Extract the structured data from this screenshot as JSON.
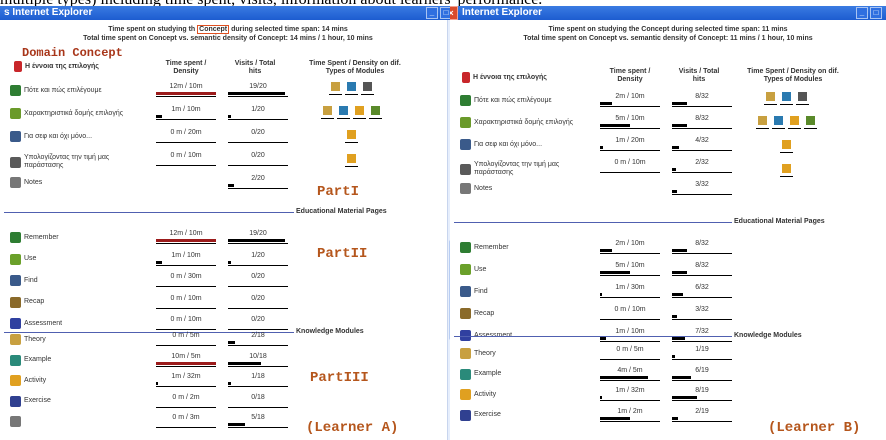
{
  "caption": "multiple types) including time spent, visits, information about learners' performance.",
  "winA": {
    "title": "s Internet Explorer",
    "time_line1_a": "Time spent on studying th",
    "time_line1_concept": "Concept",
    "time_line1_b": "during selected time span: 14 mins",
    "time_line2": "Total time spent on Concept vs. semantic density of Concept: 14 mins / 1 hour, 10 mins",
    "domain_concept": "Domain Concept",
    "concept_name": "Η έννοια της επιλογής",
    "hdr_time": "Time spent / Density",
    "hdr_visits": "Visits / Total hits",
    "hdr_modules": "Time Spent / Density on dif. Types of Modules",
    "rows1": [
      {
        "label": "Πότε και πώς επιλέγουμε",
        "time": "12m / 10m",
        "visits": "19/20",
        "red": 1,
        "tf": 1.0,
        "vf": 0.95
      },
      {
        "label": "Χαρακτηριστικά δομής επιλογής",
        "time": "1m / 10m",
        "visits": "1/20",
        "red": 0,
        "tf": 0.1,
        "vf": 0.05
      },
      {
        "label": "Για σεφ και όχι μόνο...",
        "time": "0 m / 20m",
        "visits": "0/20",
        "red": 0,
        "tf": 0,
        "vf": 0
      },
      {
        "label": "Υπολογίζοντας την τιμή μας παράστασης",
        "time": "0 m / 10m",
        "visits": "0/20",
        "red": 0,
        "tf": 0,
        "vf": 0
      },
      {
        "label": "Notes",
        "time": "",
        "visits": "2/20",
        "red": 0,
        "tf": 0,
        "vf": 0.1
      }
    ],
    "sec2": "Educational Material Pages",
    "rows2": [
      {
        "label": "Remember",
        "time": "12m / 10m",
        "visits": "19/20",
        "red": 1,
        "tf": 1.0,
        "vf": 0.95
      },
      {
        "label": "Use",
        "time": "1m / 10m",
        "visits": "1/20",
        "red": 0,
        "tf": 0.1,
        "vf": 0.05
      },
      {
        "label": "Find",
        "time": "0 m / 30m",
        "visits": "0/20",
        "red": 0,
        "tf": 0,
        "vf": 0
      },
      {
        "label": "Recap",
        "time": "0 m / 10m",
        "visits": "0/20",
        "red": 0,
        "tf": 0,
        "vf": 0
      },
      {
        "label": "Assessment",
        "time": "0 m / 10m",
        "visits": "0/20",
        "red": 0,
        "tf": 0,
        "vf": 0
      }
    ],
    "sec3": "Knowledge Modules",
    "rows3": [
      {
        "label": "Theory",
        "time": "0 m / 5m",
        "visits": "2/18",
        "red": 0,
        "tf": 0,
        "vf": 0.11
      },
      {
        "label": "Example",
        "time": "10m / 5m",
        "visits": "10/18",
        "red": 1,
        "tf": 1.0,
        "vf": 0.55
      },
      {
        "label": "Activity",
        "time": "1m / 32m",
        "visits": "1/18",
        "red": 0,
        "tf": 0.03,
        "vf": 0.05
      },
      {
        "label": "Exercise",
        "time": "0 m / 2m",
        "visits": "0/18",
        "red": 0,
        "tf": 0,
        "vf": 0
      },
      {
        "label": "",
        "time": "0 m / 3m",
        "visits": "5/18",
        "red": 0,
        "tf": 0,
        "vf": 0.28
      }
    ],
    "part1": "PartI",
    "part2": "PartII",
    "part3": "PartIII",
    "learner": "(Learner A)"
  },
  "winB": {
    "title": "Internet Explorer",
    "time_line1": "Time spent on studying the Concept during selected time span: 11 mins",
    "time_line2": "Total time spent on Concept vs. semantic density of Concept: 11 mins / 1 hour, 10 mins",
    "concept_name": "Η έννοια της επιλογής",
    "hdr_time": "Time spent / Density",
    "hdr_visits": "Visits / Total hits",
    "hdr_modules": "Time Spent / Density on dif. Types of Modules",
    "rows1": [
      {
        "label": "Πότε και πώς επιλέγουμε",
        "time": "2m / 10m",
        "visits": "8/32",
        "tf": 0.2,
        "vf": 0.25
      },
      {
        "label": "Χαρακτηριστικά δομής επιλογής",
        "time": "5m / 10m",
        "visits": "8/32",
        "tf": 0.5,
        "vf": 0.25
      },
      {
        "label": "Για σεφ και όχι μόνο...",
        "time": "1m / 20m",
        "visits": "4/32",
        "tf": 0.05,
        "vf": 0.12
      },
      {
        "label": "Υπολογίζοντας την τιμή μας παράστασης",
        "time": "0 m / 10m",
        "visits": "2/32",
        "tf": 0,
        "vf": 0.06
      },
      {
        "label": "Notes",
        "time": "",
        "visits": "3/32",
        "tf": 0,
        "vf": 0.09
      }
    ],
    "sec2": "Educational Material Pages",
    "rows2": [
      {
        "label": "Remember",
        "time": "2m / 10m",
        "visits": "8/32",
        "tf": 0.2,
        "vf": 0.25
      },
      {
        "label": "Use",
        "time": "5m / 10m",
        "visits": "8/32",
        "tf": 0.5,
        "vf": 0.25
      },
      {
        "label": "Find",
        "time": "1m / 30m",
        "visits": "6/32",
        "tf": 0.03,
        "vf": 0.19
      },
      {
        "label": "Recap",
        "time": "0 m / 10m",
        "visits": "3/32",
        "tf": 0,
        "vf": 0.09
      },
      {
        "label": "Assessment",
        "time": "1m / 10m",
        "visits": "7/32",
        "tf": 0.1,
        "vf": 0.22
      }
    ],
    "sec3": "Knowledge Modules",
    "rows3": [
      {
        "label": "Theory",
        "time": "0 m / 5m",
        "visits": "1/19",
        "tf": 0,
        "vf": 0.05
      },
      {
        "label": "Example",
        "time": "4m / 5m",
        "visits": "6/19",
        "tf": 0.8,
        "vf": 0.32
      },
      {
        "label": "Activity",
        "time": "1m / 32m",
        "visits": "8/19",
        "tf": 0.03,
        "vf": 0.42
      },
      {
        "label": "Exercise",
        "time": "1m / 2m",
        "visits": "2/19",
        "tf": 0.5,
        "vf": 0.1
      }
    ],
    "learner": "(Learner B)"
  },
  "colors": {
    "accent": "#b5561c",
    "red_bar": "#9b1b1b",
    "titlebar": "#1d5cd0",
    "separator": "#5060b0"
  }
}
